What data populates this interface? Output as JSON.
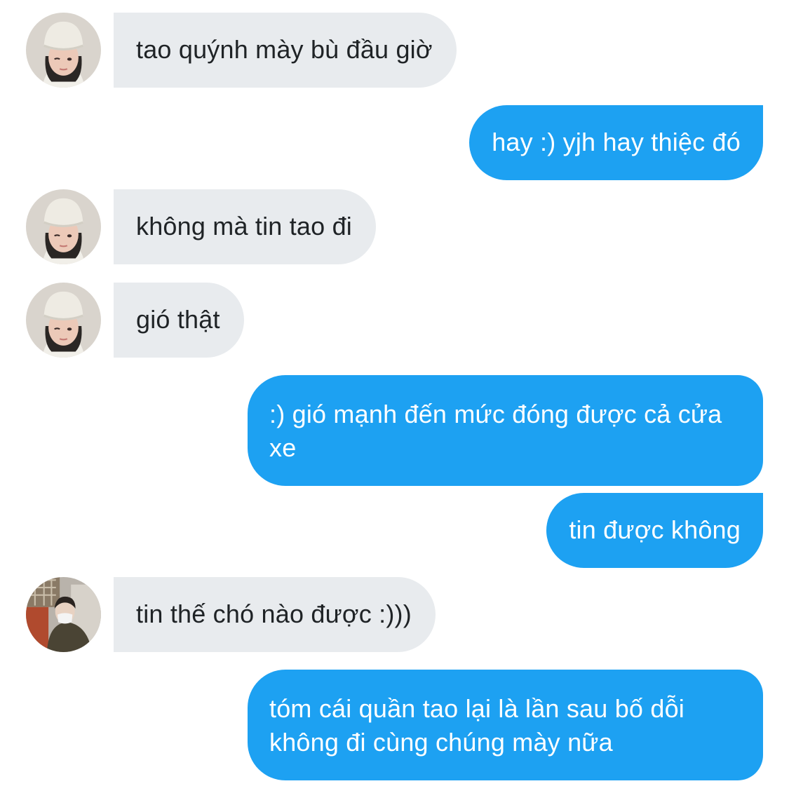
{
  "conversation": {
    "messages": [
      {
        "direction": "incoming",
        "text": "tao quýnh mày bù đầu giờ",
        "avatar": "beanie-person-avatar"
      },
      {
        "direction": "outgoing",
        "text": "hay :) yjh hay thiệc đó"
      },
      {
        "direction": "incoming",
        "text": "không mà tin tao đi",
        "avatar": "beanie-person-avatar"
      },
      {
        "direction": "incoming",
        "text": "gió thật",
        "avatar": "beanie-person-avatar"
      },
      {
        "direction": "outgoing",
        "text": ":) gió mạnh đến mức đóng được cả cửa xe"
      },
      {
        "direction": "outgoing",
        "text": "tin được không"
      },
      {
        "direction": "incoming",
        "text": "tin thế chó nào được :)))",
        "avatar": "masked-person-avatar"
      },
      {
        "direction": "outgoing",
        "text": "tóm cái quần tao lại là lần sau bố dỗi không đi cùng chúng mày nữa"
      }
    ]
  },
  "colors": {
    "incoming_bubble": "#e8ebee",
    "incoming_text": "#1f2326",
    "outgoing_bubble": "#1da1f2",
    "outgoing_text": "#ffffff",
    "background": "#ffffff"
  }
}
